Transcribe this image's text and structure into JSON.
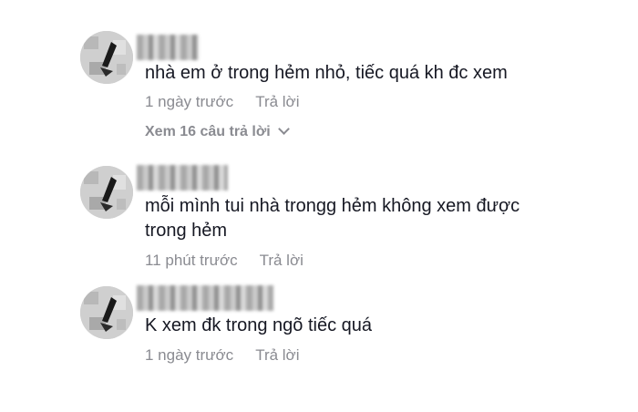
{
  "comments": [
    {
      "avatar_icon": "sketch-avatar-icon",
      "username_blurred": true,
      "text": "nhà em ở trong hẻm nhỏ, tiếc quá kh đc xem",
      "time": "1 ngày trước",
      "reply_label": "Trả lời"
    },
    {
      "avatar_icon": "sketch-avatar-icon",
      "username_blurred": true,
      "text_line1": "mỗi mình tui nhà trongg hẻm không xem được",
      "text_line2": "trong hẻm",
      "time": "11 phút trước",
      "reply_label": "Trả lời"
    },
    {
      "avatar_icon": "sketch-avatar-icon",
      "username_blurred": true,
      "text": "K xem đk trong ngõ tiếc quá",
      "time": "1 ngày trước",
      "reply_label": "Trả lời"
    }
  ],
  "view_replies_label": "Xem 16 câu trả lời",
  "colors": {
    "text": "#161823",
    "meta": "#8a8b91",
    "background": "#ffffff"
  }
}
